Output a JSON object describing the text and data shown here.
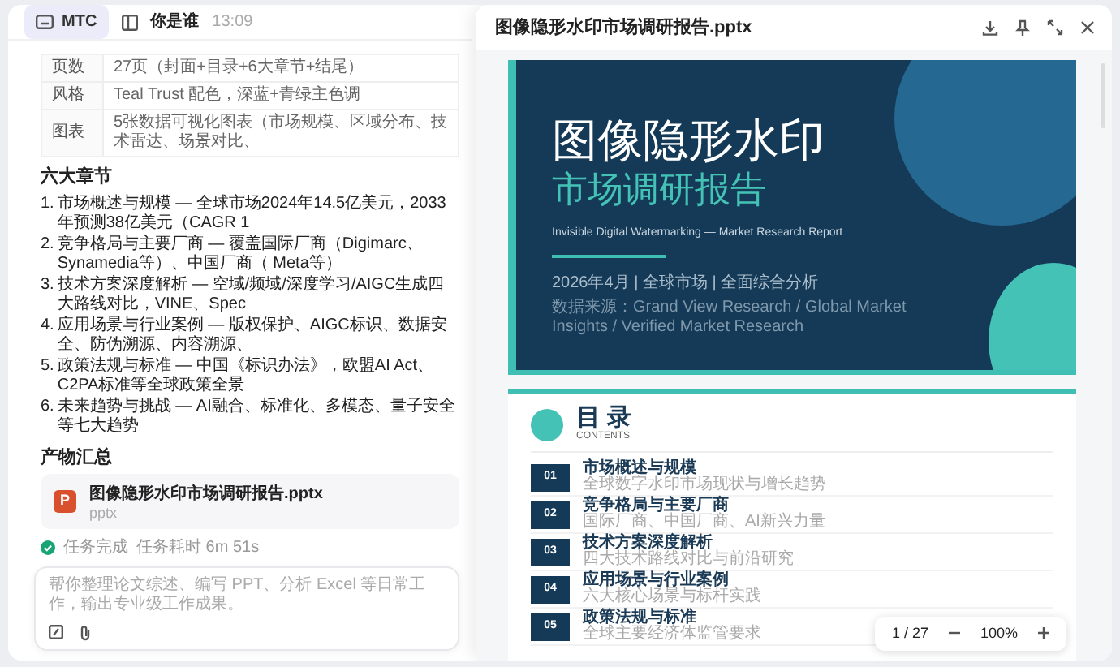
{
  "header": {
    "app_button": "MTC",
    "title": "你是谁",
    "time": "13:09"
  },
  "spec_table": [
    {
      "label": "页数",
      "value": "27页（封面+目录+6大章节+结尾）"
    },
    {
      "label": "风格",
      "value": "Teal Trust 配色，深蓝+青绿主色调"
    },
    {
      "label": "图表",
      "value": "5张数据可视化图表（市场规模、区域分布、技术雷达、场景对比、"
    }
  ],
  "chapters": {
    "heading": "六大章节",
    "items": [
      {
        "number": "1.",
        "text": "市场概述与规模 — 全球市场2024年14.5亿美元，2033年预测38亿美元（CAGR 1"
      },
      {
        "number": "2.",
        "text": "竞争格局与主要厂商 — 覆盖国际厂商（Digimarc、Synamedia等）、中国厂商（ Meta等）"
      },
      {
        "number": "3.",
        "text": "技术方案深度解析 — 空域/频域/深度学习/AIGC生成四大路线对比，VINE、Spec"
      },
      {
        "number": "4.",
        "text": "应用场景与行业案例 — 版权保护、AIGC标识、数据安全、防伪溯源、内容溯源、"
      },
      {
        "number": "5.",
        "text": "政策法规与标准 — 中国《标识办法》，欧盟AI Act、C2PA标准等全球政策全景"
      },
      {
        "number": "6.",
        "text": "未来趋势与挑战 — AI融合、标准化、多模态、量子安全等七大趋势"
      }
    ]
  },
  "outputs": {
    "heading": "产物汇总",
    "files": [
      {
        "name": "图像隐形水印市场调研报告.pptx",
        "type": "pptx",
        "icon_letter": "P"
      }
    ]
  },
  "task_status": {
    "label": "任务完成",
    "duration": "任务耗时 6m 51s"
  },
  "composer": {
    "placeholder": "帮你整理论文综述、编写 PPT、分析 Excel 等日常工作，输出专业级工作成果。"
  },
  "preview": {
    "title": "图像隐形水印市场调研报告.pptx",
    "cover": {
      "title": "图像隐形水印",
      "subtitle": "市场调研报告",
      "english": "Invisible Digital Watermarking — Market Research Report",
      "meta": "2026年4月  |  全球市场  |  全面综合分析",
      "source": "数据来源：Grand View Research / Global Market Insights / Verified Market Research"
    },
    "toc": {
      "heading": "目 录",
      "subheading": "CONTENTS",
      "items": [
        {
          "number": "01",
          "title": "市场概述与规模",
          "subtitle": "全球数字水印市场现状与增长趋势"
        },
        {
          "number": "02",
          "title": "竞争格局与主要厂商",
          "subtitle": "国际厂商、中国厂商、AI新兴力量"
        },
        {
          "number": "03",
          "title": "技术方案深度解析",
          "subtitle": "四大技术路线对比与前沿研究"
        },
        {
          "number": "04",
          "title": "应用场景与行业案例",
          "subtitle": "六大核心场景与标杆实践"
        },
        {
          "number": "05",
          "title": "政策法规与标准",
          "subtitle": "全球主要经济体监管要求"
        }
      ]
    },
    "pager": {
      "page": "1 / 27",
      "zoom": "100%"
    }
  }
}
